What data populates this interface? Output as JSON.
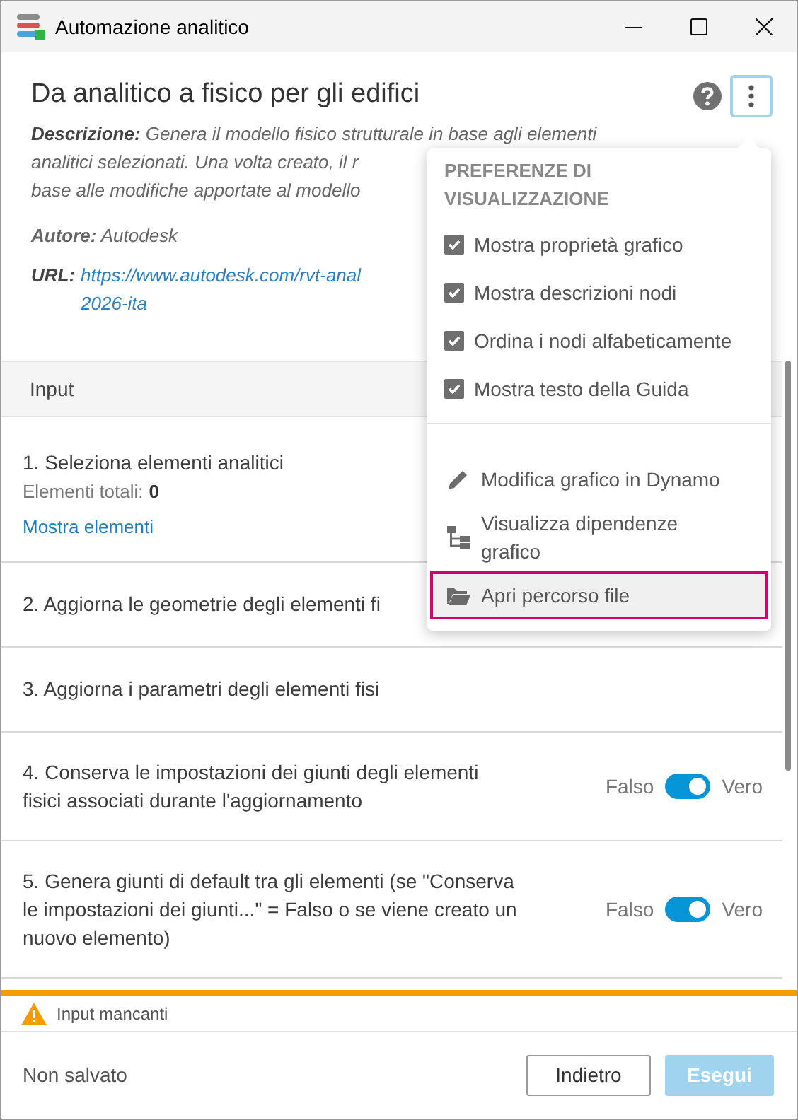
{
  "window": {
    "title": "Automazione analitico"
  },
  "header": {
    "title": "Da analitico a fisico per gli edifici"
  },
  "description_lines": [
    "**Descrizione:** Genera il modello fisico strutturale in base agli elementi",
    "analitici selezionati. Una volta creato, il r",
    "base alle modifiche apportate al modello"
  ],
  "author": "**Autore:** Autodesk",
  "url": {
    "label": "URL:",
    "lines": [
      "https://www.autodesk.com/rvt-anal",
      "2026-ita"
    ]
  },
  "section": {
    "title": "Input"
  },
  "inputs": [
    {
      "kind": "selection",
      "label": "1. Seleziona elementi analitici",
      "count_label": "Elementi totali:",
      "count": "0",
      "link": "Mostra elementi"
    },
    {
      "kind": "text",
      "label": "2. Aggiorna le geometrie degli elementi fi"
    },
    {
      "kind": "text",
      "label": "3. Aggiorna i parametri degli elementi fisi"
    },
    {
      "kind": "toggle",
      "label": "4. Conserva le impostazioni dei giunti degli elementi fisici associati durante l'aggiornamento",
      "off_label": "Falso",
      "on_label": "Vero",
      "on": true
    },
    {
      "kind": "toggle",
      "label": "5. Genera giunti di default tra gli elementi (se \"Conserva le impostazioni dei giunti...\" = Falso o se viene creato un nuovo elemento)",
      "off_label": "Falso",
      "on_label": "Vero",
      "on": true
    }
  ],
  "warning": "Input mancanti",
  "footer": {
    "status": "Non salvato",
    "buttons": [
      {
        "label": "Indietro",
        "disabled": false
      },
      {
        "label": "Esegui",
        "disabled": true
      }
    ]
  },
  "menu": {
    "heading": "PREFERENZE DI VISUALIZZAZIONE",
    "options": [
      {
        "label": "Mostra proprietà grafico",
        "checked": true
      },
      {
        "label": "Mostra descrizioni nodi",
        "checked": true
      },
      {
        "label": "Ordina i nodi alfabeticamente",
        "checked": true
      },
      {
        "label": "Mostra testo della Guida",
        "checked": true
      }
    ],
    "actions": [
      {
        "kind": "edit",
        "label": "Modifica grafico in Dynamo",
        "selected": false
      },
      {
        "kind": "dependencies",
        "label": "Visualizza dipendenze grafico",
        "selected": false
      },
      {
        "kind": "folder",
        "label": "Apri percorso file",
        "selected": true
      }
    ]
  }
}
